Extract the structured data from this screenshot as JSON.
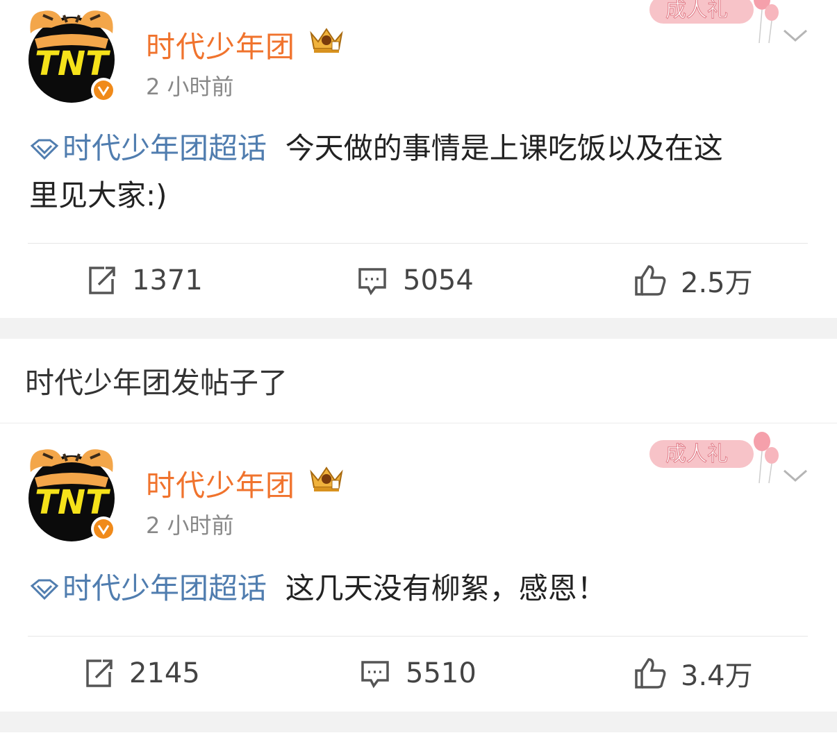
{
  "posts": [
    {
      "username": "时代少年团",
      "time": "2 小时前",
      "badge_text": "成人礼",
      "topic": "时代少年团超话",
      "text_line1": "今天做的事情是上课吃饭以及在这",
      "text_line2": "里见大家:)",
      "repost_count": "1371",
      "comment_count": "5054",
      "like_count": "2.5万"
    },
    {
      "username": "时代少年团",
      "time": "2 小时前",
      "badge_text": "成人礼",
      "topic": "时代少年团超话",
      "text_line1": "这几天没有柳絮，感恩！",
      "repost_count": "2145",
      "comment_count": "5510",
      "like_count": "3.4万"
    }
  ],
  "feed_header": "时代少年团发帖子了",
  "avatar_text": "TNT",
  "colors": {
    "username": "#f0732d",
    "topic": "#507daf",
    "separator": "#f2f2f2"
  },
  "icons": [
    "repost-icon",
    "comment-icon",
    "like-icon",
    "crown-icon",
    "verified-icon",
    "chevron-down-icon",
    "topic-diamond-icon"
  ]
}
